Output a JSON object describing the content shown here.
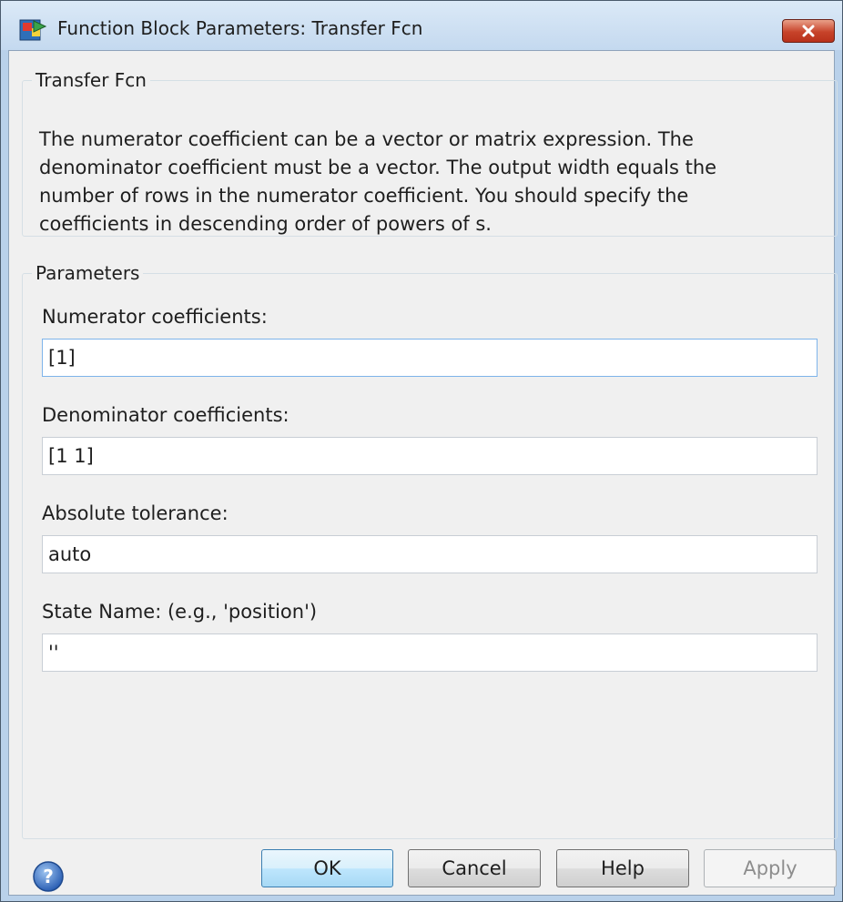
{
  "window": {
    "title": "Function Block Parameters: Transfer Fcn"
  },
  "description_group": {
    "legend": "Transfer Fcn",
    "lines": [
      "The numerator coefficient can be a vector or matrix expression. The",
      "denominator coefficient must be a vector. The output width equals the",
      "number of rows in the numerator coefficient. You should specify the",
      "coefficients in descending order of powers of s."
    ]
  },
  "parameters": {
    "legend": "Parameters",
    "fields": [
      {
        "label": "Numerator coefficients:",
        "value": "[1]"
      },
      {
        "label": "Denominator coefficients:",
        "value": "[1 1]"
      },
      {
        "label": "Absolute tolerance:",
        "value": "auto"
      },
      {
        "label": "State Name: (e.g., 'position')",
        "value": "''"
      }
    ]
  },
  "buttons": {
    "ok": "OK",
    "cancel": "Cancel",
    "help": "Help",
    "apply": "Apply"
  },
  "icons": {
    "app": "simulink-block-icon",
    "close": "close-icon",
    "help": "help-question-icon"
  },
  "colors": {
    "title_bar": "#c4d9ef",
    "close_button": "#c7432a",
    "dialog_bg": "#f0f0f0",
    "focus_border": "#7eb4ea"
  }
}
